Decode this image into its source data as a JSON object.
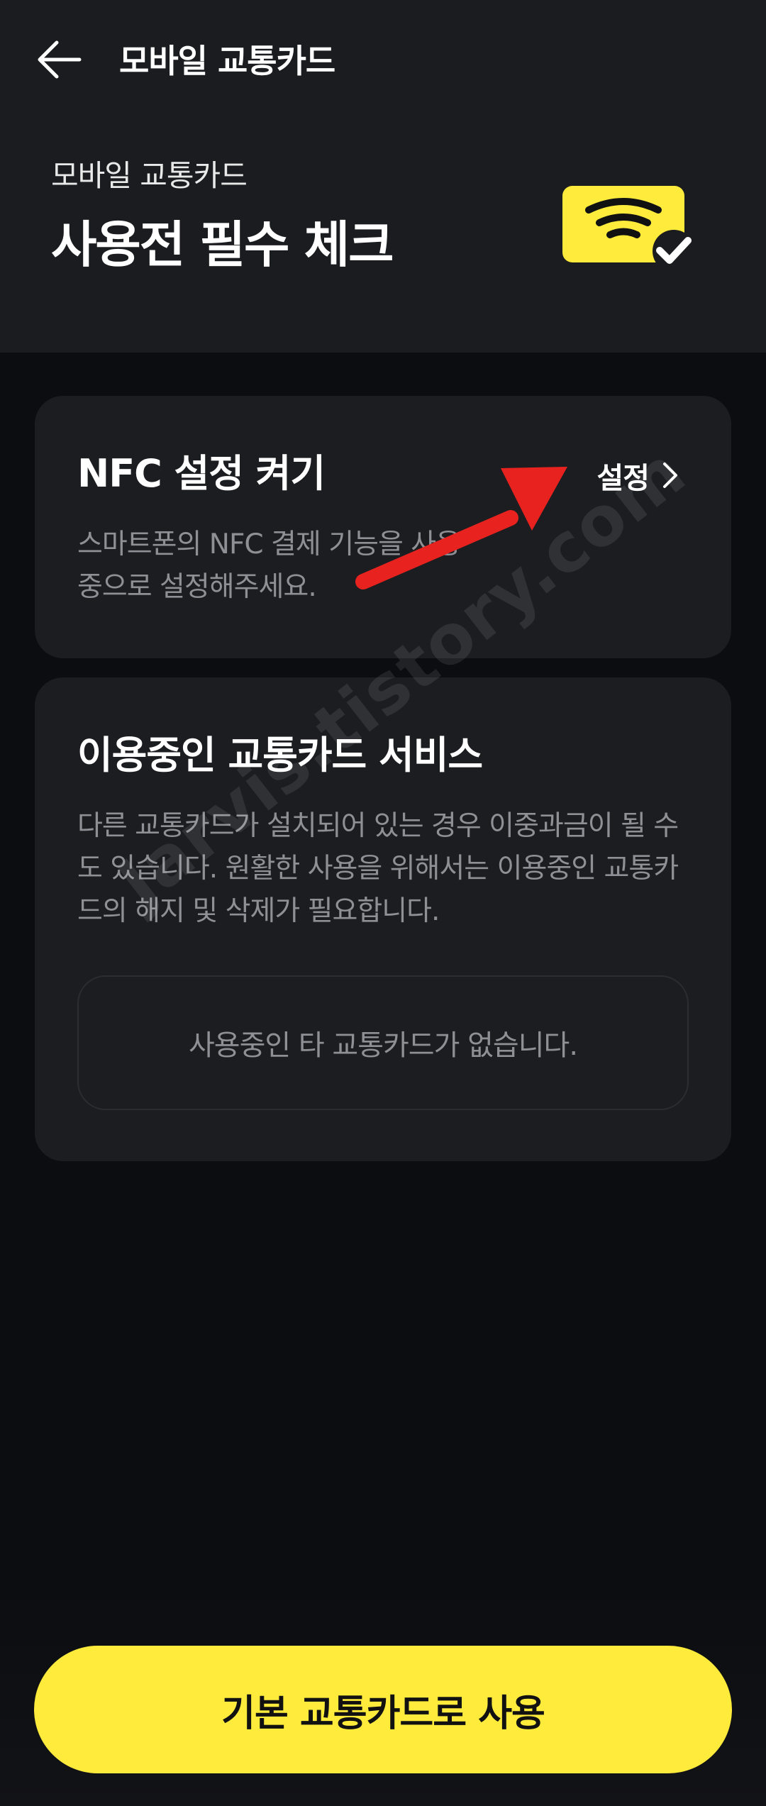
{
  "topbar": {
    "back_icon": "arrow-left-icon",
    "title": "모바일 교통카드"
  },
  "hero": {
    "subtitle": "모바일 교통카드",
    "title": "사용전 필수 체크",
    "icon": "nfc-card-check-icon",
    "icon_color": "#FFEB3B"
  },
  "nfc_card": {
    "title": "NFC 설정 켜기",
    "description": "스마트폰의 NFC 결제 기능을 사용중으로 설정해주세요.",
    "settings_label": "설정",
    "settings_icon": "chevron-right-icon"
  },
  "service_card": {
    "title": "이용중인 교통카드 서비스",
    "description": "다른 교통카드가 설치되어 있는 경우 이중과금이 될 수도 있습니다. 원활한 사용을 위해서는 이용중인 교통카드의 해지 및 삭제가 필요합니다.",
    "empty_text": "사용중인 타 교통카드가 없습니다."
  },
  "annotation": {
    "icon": "red-arrow-annotation",
    "color": "#E8231F"
  },
  "watermark": "Jarvis.tistory.com",
  "primary_button": {
    "label": "기본 교통카드로 사용",
    "color": "#FFEB3B"
  }
}
